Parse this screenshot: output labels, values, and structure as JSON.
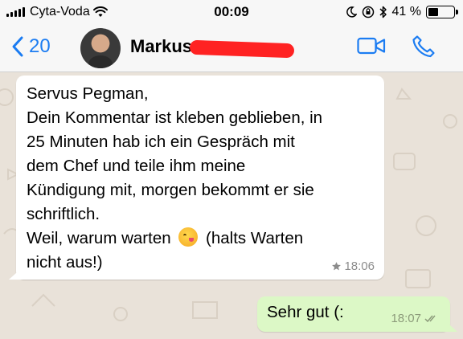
{
  "status_bar": {
    "carrier": "Cyta-Voda",
    "time": "00:09",
    "battery_text": "41 %",
    "battery_level": 0.41
  },
  "nav": {
    "back_count": "20",
    "contact_name": "Markus"
  },
  "messages": {
    "incoming": {
      "lines": [
        "Servus Pegman,",
        "Dein Kommentar ist kleben geblieben, in",
        "25 Minuten hab ich ein Gespräch mit",
        "dem Chef und teile ihm meine",
        "Kündigung mit, morgen bekommt er sie",
        "schriftlich.",
        "Weil, warum warten",
        "(halts Warten",
        "nicht aus!)"
      ],
      "emoji": "savoring-food-face",
      "starred": true,
      "time": "18:06"
    },
    "outgoing": {
      "text": "Sehr gut (:",
      "time": "18:07",
      "status": "read"
    }
  },
  "colors": {
    "accent": "#1b7cf2",
    "chat_background": "#e9e2d9",
    "incoming_bubble": "#ffffff",
    "outgoing_bubble": "#dcf8c6",
    "redaction": "#ff2222"
  }
}
